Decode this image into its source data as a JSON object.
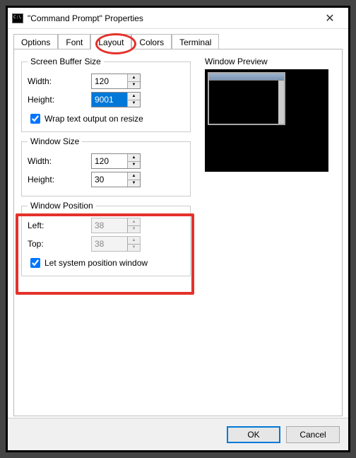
{
  "window": {
    "title": "\"Command Prompt\" Properties"
  },
  "tabs": {
    "options": "Options",
    "font": "Font",
    "layout": "Layout",
    "colors": "Colors",
    "terminal": "Terminal"
  },
  "buffer": {
    "legend": "Screen Buffer Size",
    "widthLabel": "Width:",
    "width": "120",
    "heightLabel": "Height:",
    "height": "9001",
    "wrap": "Wrap text output on resize"
  },
  "winsize": {
    "legend": "Window Size",
    "widthLabel": "Width:",
    "width": "120",
    "heightLabel": "Height:",
    "height": "30"
  },
  "winpos": {
    "legend": "Window Position",
    "leftLabel": "Left:",
    "left": "38",
    "topLabel": "Top:",
    "top": "38",
    "auto": "Let system position window"
  },
  "preview": {
    "label": "Window Preview"
  },
  "buttons": {
    "ok": "OK",
    "cancel": "Cancel"
  }
}
